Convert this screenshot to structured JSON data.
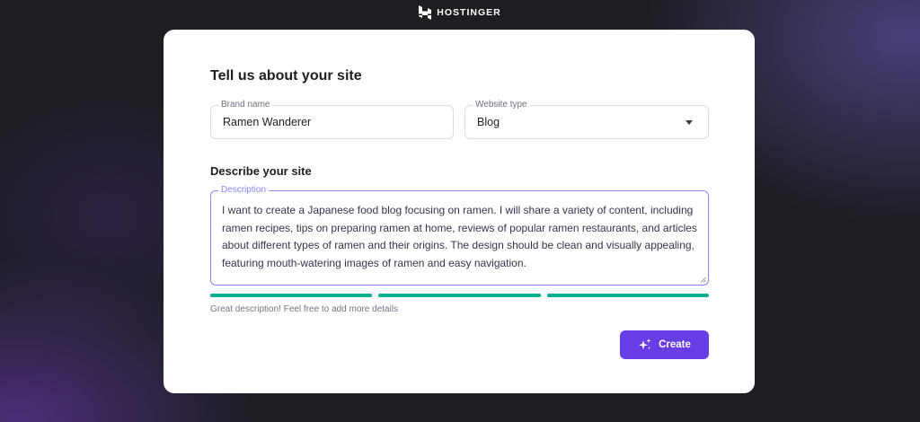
{
  "header": {
    "brand": "HOSTINGER"
  },
  "form": {
    "title": "Tell us about your site",
    "brand_name": {
      "label": "Brand name",
      "value": "Ramen Wanderer"
    },
    "website_type": {
      "label": "Website type",
      "value": "Blog"
    },
    "describe_title": "Describe your site",
    "description": {
      "label": "Description",
      "value": "I want to create a Japanese food blog focusing on ramen. I will share a variety of content, including ramen recipes, tips on preparing ramen at home, reviews of popular ramen restaurants, and articles about different types of ramen and their origins. The design should be clean and visually appealing, featuring mouth-watering images of ramen and easy navigation."
    },
    "strength_bars_filled": 3,
    "strength_bars_total": 3,
    "hint": "Great description! Feel free to add more details",
    "create_label": "Create"
  },
  "colors": {
    "accent": "#673de6",
    "success": "#00b090",
    "focus": "#8c85ff"
  },
  "icons": {
    "logo": "hostinger-logo-icon",
    "dropdown": "caret-down-icon",
    "create": "sparkles-icon"
  }
}
